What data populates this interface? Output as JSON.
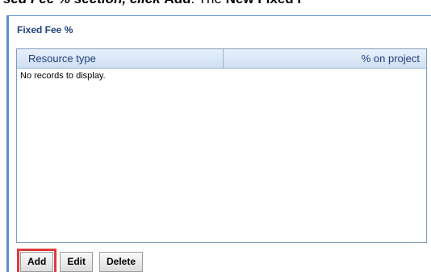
{
  "instruction_text": {
    "part1": "sed Fee % section, click ",
    "part2": "Add",
    "part3": ". The ",
    "part4": "New Fixed F"
  },
  "panel": {
    "title": "Fixed Fee %",
    "grid": {
      "columns": [
        "Resource type",
        "% on project"
      ],
      "empty_message": "No records to display."
    },
    "buttons": {
      "add": "Add",
      "edit": "Edit",
      "delete": "Delete"
    }
  },
  "colors": {
    "panel_border": "#5b8fd0",
    "title_color": "#1f3f7a",
    "highlight": "#e0393b"
  }
}
